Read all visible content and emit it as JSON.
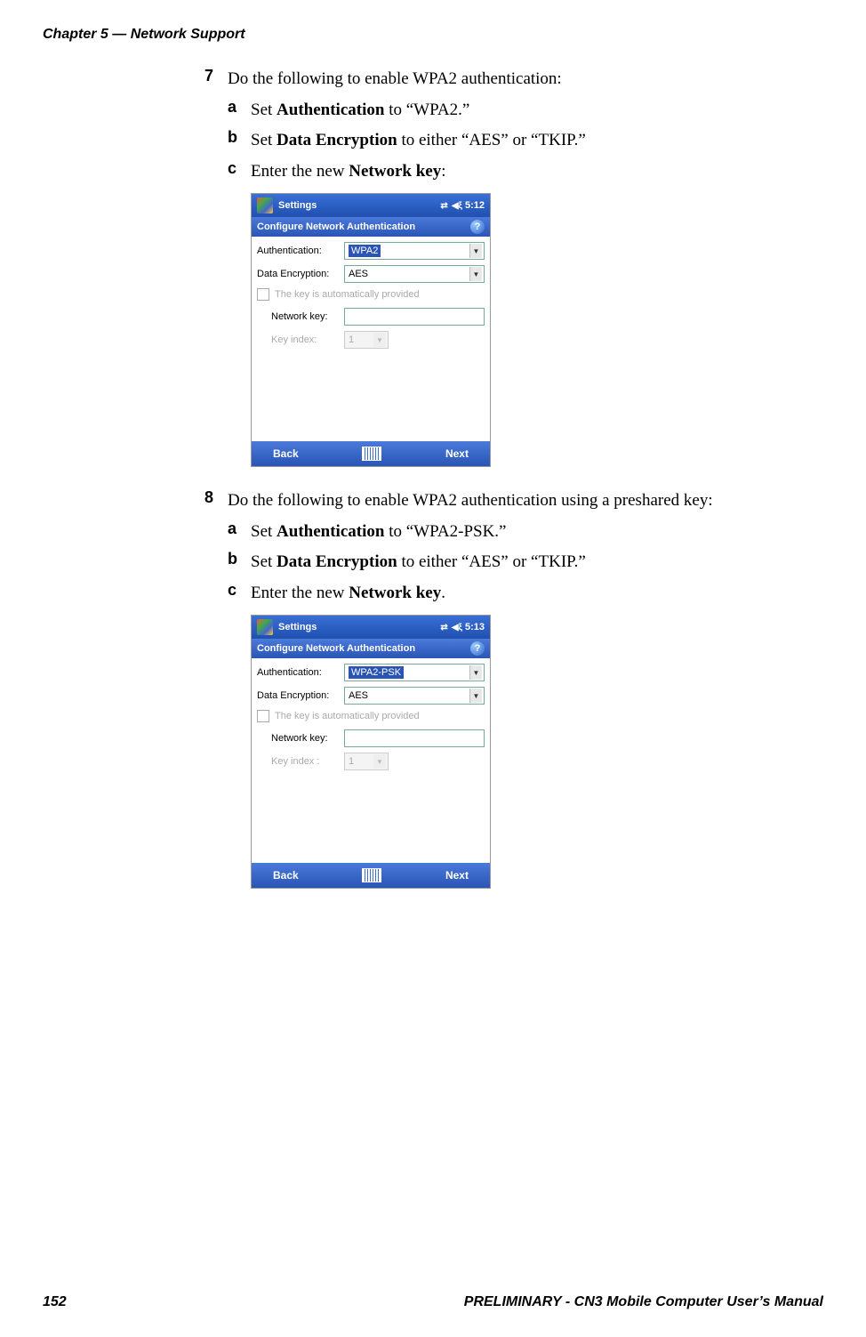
{
  "header": "Chapter 5 — Network Support",
  "step7": {
    "num": "7",
    "text": "Do the following to enable WPA2 authentication:",
    "a": {
      "letter": "a",
      "pre": "Set ",
      "bold": "Authentication",
      "post": " to “WPA2.”"
    },
    "b": {
      "letter": "b",
      "pre": "Set ",
      "bold": "Data Encryption",
      "post": " to either “AES” or “TKIP.”"
    },
    "c": {
      "letter": "c",
      "pre": "Enter the new ",
      "bold": "Network key",
      "post": ":"
    }
  },
  "shot1": {
    "tb_title": "Settings",
    "tb_time": "5:12",
    "subhead": "Configure Network Authentication",
    "auth_label": "Authentication:",
    "auth_value": "WPA2",
    "enc_label": "Data Encryption:",
    "enc_value": "AES",
    "auto_text": "The key is automatically provided",
    "key_label": "Network key:",
    "idx_label": "Key index:",
    "idx_value": "1",
    "back": "Back",
    "next": "Next"
  },
  "step8": {
    "num": "8",
    "text": "Do the following to enable WPA2 authentication using a preshared key:",
    "a": {
      "letter": "a",
      "pre": "Set ",
      "bold": "Authentication",
      "post": " to “WPA2-PSK.”"
    },
    "b": {
      "letter": "b",
      "pre": "Set ",
      "bold": "Data Encryption",
      "post": " to either “AES” or “TKIP.”"
    },
    "c": {
      "letter": "c",
      "pre": "Enter the new ",
      "bold": "Network key",
      "post": "."
    }
  },
  "shot2": {
    "tb_title": "Settings",
    "tb_time": "5:13",
    "subhead": "Configure Network Authentication",
    "auth_label": "Authentication:",
    "auth_value": "WPA2-PSK",
    "enc_label": "Data Encryption:",
    "enc_value": "AES",
    "auto_text": "The key is automatically provided",
    "key_label": "Network key:",
    "idx_label": "Key index :",
    "idx_value": "1",
    "back": "Back",
    "next": "Next"
  },
  "footer": {
    "page": "152",
    "right": "PRELIMINARY - CN3 Mobile Computer User’s Manual"
  }
}
